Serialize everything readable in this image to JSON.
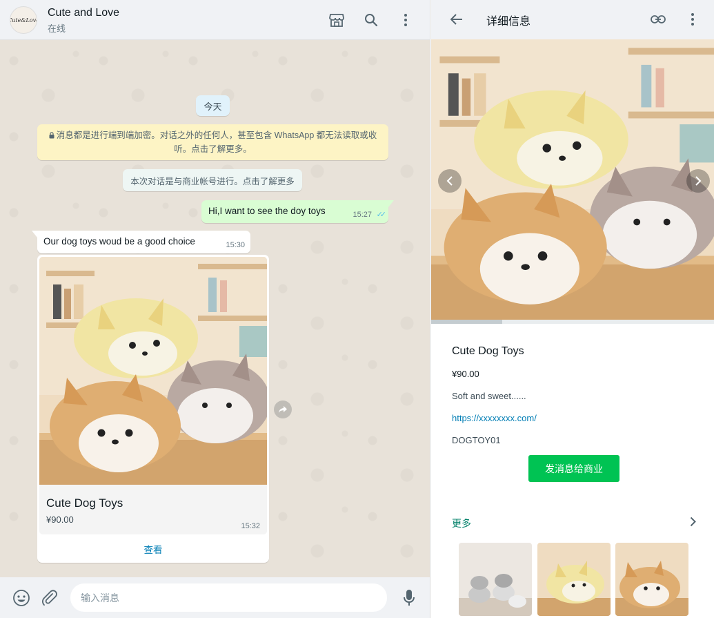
{
  "chat": {
    "header": {
      "avatar_text": "Cute&Love",
      "contact_name": "Cute and Love",
      "status": "在线",
      "icons": [
        "store-icon",
        "search-icon",
        "menu-icon"
      ]
    },
    "date_chip": "今天",
    "e2e_notice": "消息都是进行端到端加密。对话之外的任何人，甚至包含 WhatsApp 都无法读取或收听。点击了解更多。",
    "business_notice": "本次对话是与商业帐号进行。点击了解更多",
    "messages": [
      {
        "direction": "out",
        "text": "Hi,I want to see the doy toys",
        "time": "15:27",
        "status": "read"
      },
      {
        "direction": "in",
        "text": "Our dog toys woud be a good choice",
        "time": "15:30"
      }
    ],
    "product_card": {
      "name": "Cute Dog Toys",
      "price": "¥90.00",
      "time": "15:32",
      "view_label": "查看"
    },
    "composer": {
      "placeholder": "输入消息"
    }
  },
  "detail": {
    "title": "详细信息",
    "gallery_progress": 0.25,
    "product": {
      "name": "Cute Dog Toys",
      "price": "¥90.00",
      "description": "Soft and sweet......",
      "link": "https://xxxxxxxx.com/",
      "sku": "DOGTOY01"
    },
    "send_button": "发消息给商业",
    "more_label": "更多",
    "thumbnails": 3
  },
  "colors": {
    "header_bg": "#f0f2f5",
    "outgoing_bubble": "#d9fdd3",
    "notice_yellow": "#fdf4c5",
    "link_blue": "#027eb5",
    "accent_green": "#00c353",
    "more_teal": "#008069"
  }
}
